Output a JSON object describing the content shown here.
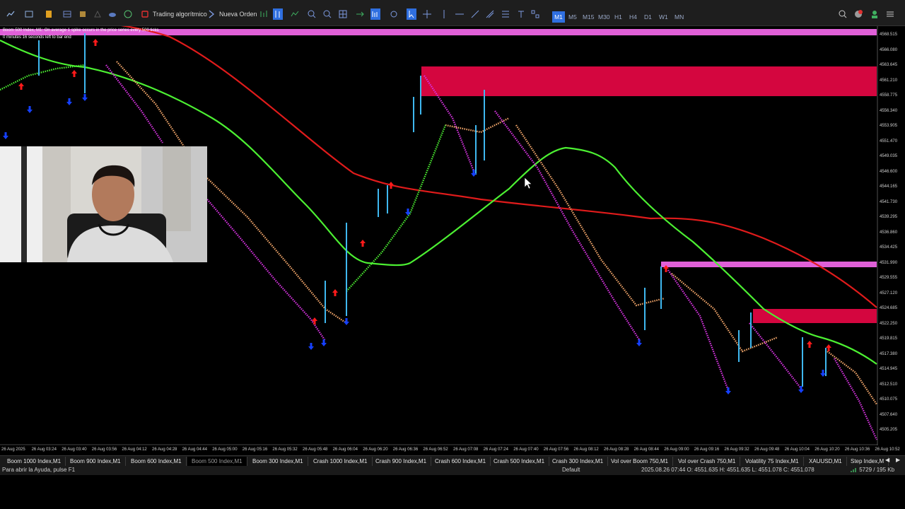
{
  "toolbar": {
    "algo_trading_label": "Trading algorítmico",
    "new_order_label": "Nueva Orden",
    "timeframes": [
      "M1",
      "M5",
      "M15",
      "M30",
      "H1",
      "H4",
      "D1",
      "W1",
      "MN"
    ],
    "active_timeframe": "M1",
    "icons": [
      "chart-type-icon",
      "templates-icon",
      "market-watch-icon",
      "data-window-icon",
      "navigator-icon",
      "strategy-tester-icon",
      "cloud-icon",
      "signals-icon",
      "algo-trading-icon",
      "new-order-icon",
      "depth-icon",
      "bar-chart-icon",
      "line-chart-icon",
      "zoom-in-icon",
      "zoom-out-icon",
      "grid-icon",
      "autoscroll-icon",
      "chart-shift-icon",
      "indicators-icon",
      "cursor-icon",
      "crosshair-icon",
      "vertical-line-icon",
      "horizontal-line-icon",
      "trendline-icon",
      "pitchfork-icon",
      "fibonacci-icon",
      "text-icon",
      "shapes-icon",
      "search-icon",
      "notification-icon",
      "account-icon",
      "menu-icon"
    ]
  },
  "chart": {
    "info_line1": "Boom 500 Index, M1:  On average 1 spike occurs in the price series every 500 ticks",
    "info_line2": "0 minutes 16 seconds left to bar end",
    "price_labels": [
      "4568.515",
      "4566.080",
      "4563.645",
      "4561.210",
      "4558.775",
      "4556.340",
      "4553.905",
      "4551.470",
      "4549.035",
      "4546.600",
      "4544.165",
      "4541.730",
      "4539.295",
      "4536.860",
      "4534.425",
      "4531.990",
      "4529.555",
      "4527.120",
      "4524.685",
      "4522.250",
      "4519.815",
      "4517.380",
      "4514.945",
      "4512.510",
      "4510.075",
      "4507.640",
      "4505.205"
    ],
    "time_labels": [
      "26 Aug 2025",
      "26 Aug 03:24",
      "26 Aug 03:40",
      "26 Aug 03:56",
      "26 Aug 04:12",
      "26 Aug 04:28",
      "26 Aug 04:44",
      "26 Aug 05:00",
      "26 Aug 05:16",
      "26 Aug 05:32",
      "26 Aug 05:48",
      "26 Aug 06:04",
      "26 Aug 06:20",
      "26 Aug 06:36",
      "26 Aug 06:52",
      "26 Aug 07:08",
      "26 Aug 07:24",
      "26 Aug 07:40",
      "26 Aug 07:56",
      "26 Aug 08:12",
      "26 Aug 08:28",
      "26 Aug 08:44",
      "26 Aug 09:00",
      "26 Aug 09:16",
      "26 Aug 09:32",
      "26 Aug 09:48",
      "26 Aug 10:04",
      "26 Aug 10:20",
      "26 Aug 10:36",
      "26 Aug 10:52"
    ],
    "colors": {
      "background": "#000000",
      "green_ma": "#4cf032",
      "red_ma": "#e01b1b",
      "magenta_series": "#d633e0",
      "orange_series": "#f2a66a",
      "blue_spike": "#3fb8f0",
      "supply_zone": "#d4063f",
      "pink_zone": "#e060d8",
      "buy_arrow": "#1540ff",
      "sell_arrow": "#ff1a1a"
    }
  },
  "tabs": {
    "items": [
      "Boom 1000 Index,M1",
      "Boom 900 Index,M1",
      "Boom 600 Index,M1",
      "Boom 500 Index,M1",
      "Boom 300 Index,M1",
      "Crash 1000 Index,M1",
      "Crash 900 Index,M1",
      "Crash 600 Index,M1",
      "Crash 500 Index,M1",
      "Crash 300 Index,M1",
      "Vol over Boom 750,M1",
      "Vol over Crash 750,M1",
      "Volatility 75 Index,M1",
      "XAUUSD,M1",
      "Step Index,M"
    ],
    "active": "Boom 500 Index,M1",
    "prev": "◀",
    "next": "▶"
  },
  "status": {
    "help": "Para abrir la Ayuda, pulse F1",
    "profile": "Default",
    "ohlc": "2025.08.26 07:44   O: 4551.635   H: 4551.635   L: 4551.078   C: 4551.078",
    "traffic": "5729 / 195 Kb"
  }
}
